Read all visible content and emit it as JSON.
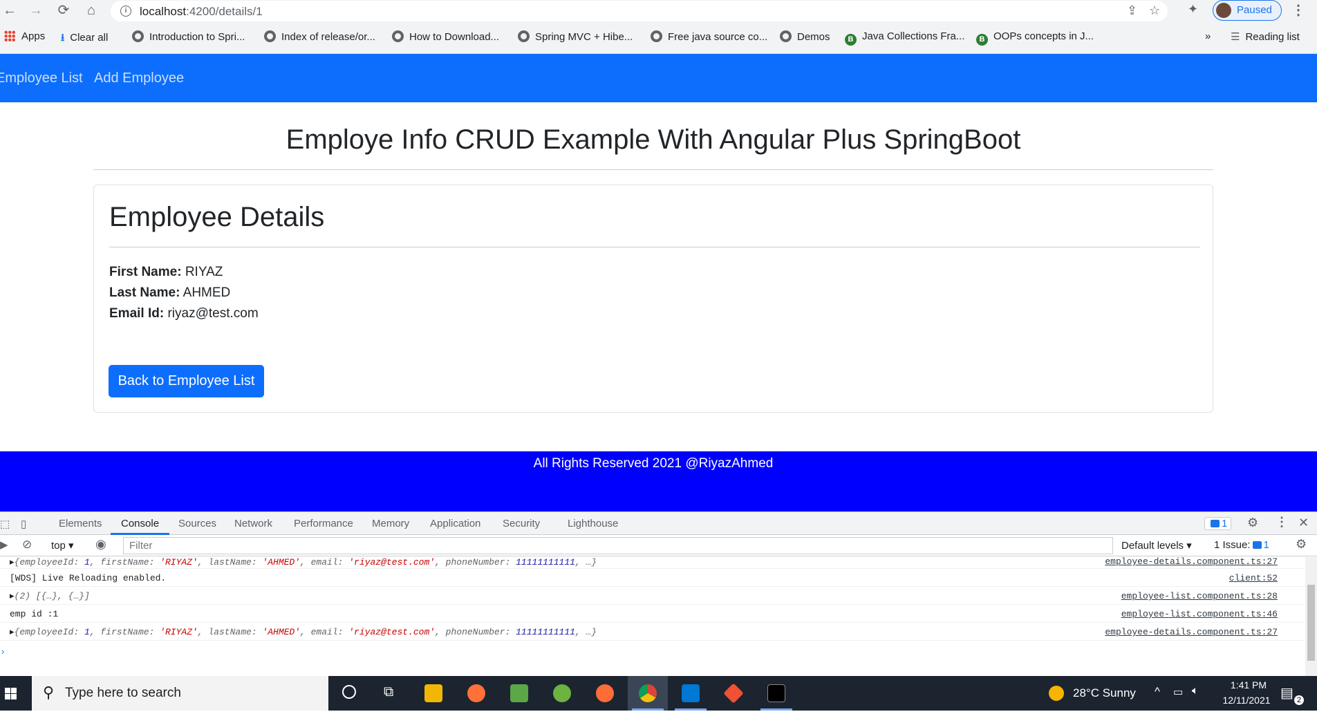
{
  "browser": {
    "url_host": "localhost",
    "url_path": ":4200/details/1",
    "profile_label": "Paused",
    "bookmarks": [
      {
        "label": "Apps",
        "icon": "apps-grid-icon"
      },
      {
        "label": "Clear all",
        "icon": "download-icon"
      },
      {
        "label": "Introduction to Spri...",
        "icon": "globe-icon"
      },
      {
        "label": "Index of release/or...",
        "icon": "globe-icon"
      },
      {
        "label": "How to Download...",
        "icon": "globe-icon"
      },
      {
        "label": "Spring MVC + Hibe...",
        "icon": "globe-icon"
      },
      {
        "label": "Free java source co...",
        "icon": "globe-icon"
      },
      {
        "label": "Demos",
        "icon": "globe-icon"
      },
      {
        "label": "Java Collections Fra...",
        "icon": "blogger-icon"
      },
      {
        "label": "OOPs concepts in J...",
        "icon": "blogger-icon"
      }
    ],
    "overflow": "»",
    "reading_list": "Reading list"
  },
  "app": {
    "nav": [
      "Employee List",
      "Add Employee"
    ],
    "page_title": "Employe Info CRUD Example With Angular Plus SpringBoot",
    "card_title": "Employee Details",
    "fields": [
      {
        "label": "First Name:",
        "value": "RIYAZ"
      },
      {
        "label": "Last Name:",
        "value": "AHMED"
      },
      {
        "label": "Email Id:",
        "value": "riyaz@test.com"
      }
    ],
    "back_button": "Back to Employee List",
    "footer": "All Rights Reserved 2021 @RiyazAhmed",
    "colors": {
      "nav": "#0d6efd",
      "footer": "#0000ff",
      "button": "#0d6efd"
    }
  },
  "devtools": {
    "tabs": [
      "Elements",
      "Console",
      "Sources",
      "Network",
      "Performance",
      "Memory",
      "Application",
      "Security",
      "Lighthouse"
    ],
    "active_tab": "Console",
    "message_count": "1",
    "context": "top",
    "filter_placeholder": "Filter",
    "levels": "Default levels",
    "issues": "1 Issue:",
    "issues_count": "1",
    "rows": [
      {
        "src": "employee-details.component.ts:27"
      },
      {
        "msg": "[WDS] Live Reloading enabled.",
        "src": "client:52"
      },
      {
        "msg": "(2) [{…}, {…}]",
        "src": "employee-list.component.ts:28"
      },
      {
        "msg": "emp id :1",
        "src": "employee-list.component.ts:46"
      },
      {
        "src": "employee-details.component.ts:27"
      }
    ],
    "object_row": {
      "k1": "{employeeId: ",
      "v1": "1",
      "k2": ", firstName: ",
      "v2": "'RIYAZ'",
      "k3": ", lastName: ",
      "v3": "'AHMED'",
      "k4": ", email: ",
      "v4": "'riyaz@test.com'",
      "k5": ", phoneNumber: ",
      "v5": "11111111111",
      "tail": ", …}"
    }
  },
  "taskbar": {
    "search_placeholder": "Type here to search",
    "weather": "28°C  Sunny",
    "time": "1:41 PM",
    "date": "12/11/2021",
    "notifications": "2"
  }
}
